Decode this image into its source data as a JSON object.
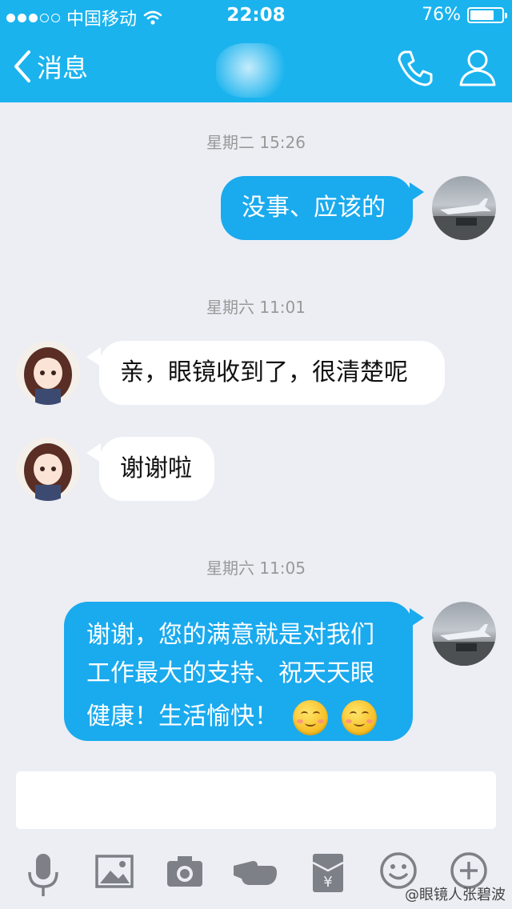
{
  "status_bar": {
    "carrier": "中国移动",
    "time": "22:08",
    "battery_percent": "76%",
    "battery_level": 0.76,
    "signal_bars_filled": 3,
    "signal_bars_total": 5
  },
  "nav": {
    "back_label": "消息",
    "icons": [
      "phone-icon",
      "contact-icon"
    ]
  },
  "messages": [
    {
      "type": "timestamp",
      "text": "星期二 15:26"
    },
    {
      "type": "outgoing",
      "text": "没事、应该的"
    },
    {
      "type": "timestamp",
      "text": "星期六 11:01"
    },
    {
      "type": "incoming",
      "text": "亲，眼镜收到了，很清楚呢"
    },
    {
      "type": "incoming",
      "text": "谢谢啦"
    },
    {
      "type": "timestamp",
      "text": "星期六 11:05"
    },
    {
      "type": "outgoing",
      "lines": [
        "谢谢，您的满意就是对我们",
        "工作最大的支持、祝天天眼",
        "健康！生活愉快！"
      ],
      "emojis": 2
    }
  ],
  "input": {
    "value": "",
    "placeholder": ""
  },
  "toolbar": {
    "icons": [
      "microphone-icon",
      "image-icon",
      "camera-icon",
      "poke-icon",
      "red-envelope-icon",
      "emoji-icon",
      "plus-icon"
    ],
    "red_envelope_symbol": "¥"
  },
  "watermark": "@眼镜人张碧波",
  "colors": {
    "accent": "#1ab3ee",
    "bubble_out": "#1aaaee",
    "bubble_in": "#ffffff",
    "background": "#eceef4"
  }
}
